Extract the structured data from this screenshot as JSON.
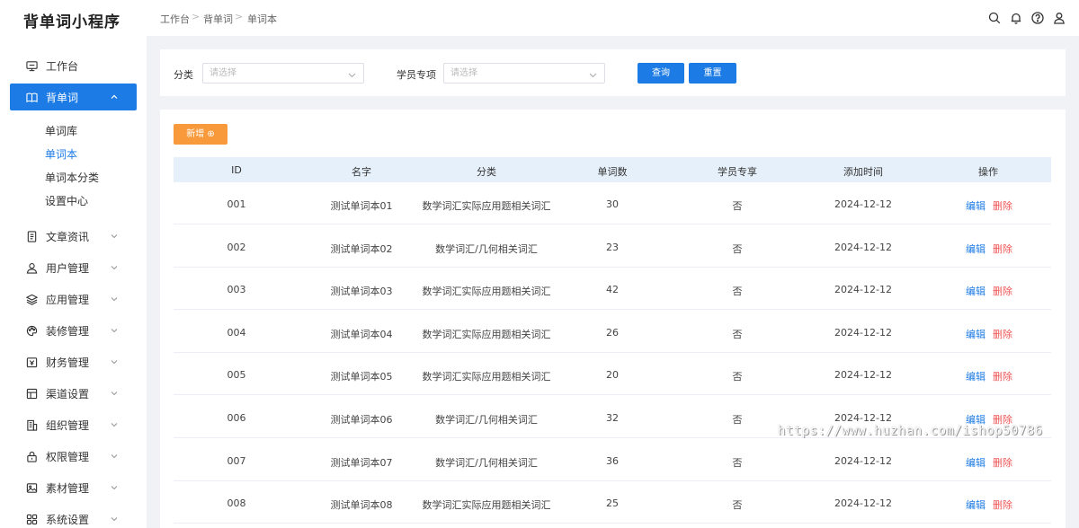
{
  "app": {
    "title": "背单词小程序"
  },
  "breadcrumb": [
    "工作台",
    "背单词",
    "单词本"
  ],
  "breadcrumb_sep": ">",
  "sidebar": {
    "items": [
      {
        "label": "工作台",
        "icon": "monitor-icon",
        "expandable": false
      },
      {
        "label": "背单词",
        "icon": "book-icon",
        "expandable": true,
        "expanded": true,
        "active": true
      },
      {
        "label": "文章资讯",
        "icon": "document-icon",
        "expandable": true
      },
      {
        "label": "用户管理",
        "icon": "user-icon",
        "expandable": true
      },
      {
        "label": "应用管理",
        "icon": "layers-icon",
        "expandable": true
      },
      {
        "label": "装修管理",
        "icon": "palette-icon",
        "expandable": true
      },
      {
        "label": "财务管理",
        "icon": "wallet-icon",
        "expandable": true
      },
      {
        "label": "渠道设置",
        "icon": "grid-icon",
        "expandable": true
      },
      {
        "label": "组织管理",
        "icon": "building-icon",
        "expandable": true
      },
      {
        "label": "权限管理",
        "icon": "lock-icon",
        "expandable": true
      },
      {
        "label": "素材管理",
        "icon": "image-icon",
        "expandable": true
      },
      {
        "label": "系统设置",
        "icon": "apps-icon",
        "expandable": true
      }
    ],
    "subitems": [
      {
        "label": "单词库",
        "active": false
      },
      {
        "label": "单词本",
        "active": true
      },
      {
        "label": "单词本分类",
        "active": false
      },
      {
        "label": "设置中心",
        "active": false
      }
    ]
  },
  "header_icons": [
    "search-icon",
    "bell-icon",
    "help-icon",
    "user-icon"
  ],
  "filters": {
    "category_label": "分类",
    "category_placeholder": "请选择",
    "student_label": "学员专项",
    "student_placeholder": "请选择",
    "query_label": "查询",
    "reset_label": "重置"
  },
  "toolbar": {
    "add_label": "新增 ⊕"
  },
  "table": {
    "columns": [
      "ID",
      "名字",
      "分类",
      "单词数",
      "学员专享",
      "添加时间",
      "操作"
    ],
    "rows": [
      {
        "id": "001",
        "name": "测试单词本01",
        "category": "数学词汇实际应用题相关词汇",
        "count": "30",
        "exclusive": "否",
        "added": "2024-12-12"
      },
      {
        "id": "002",
        "name": "测试单词本02",
        "category": "数学词汇/几何相关词汇",
        "count": "23",
        "exclusive": "否",
        "added": "2024-12-12"
      },
      {
        "id": "003",
        "name": "测试单词本03",
        "category": "数学词汇实际应用题相关词汇",
        "count": "42",
        "exclusive": "否",
        "added": "2024-12-12"
      },
      {
        "id": "004",
        "name": "测试单词本04",
        "category": "数学词汇实际应用题相关词汇",
        "count": "26",
        "exclusive": "否",
        "added": "2024-12-12"
      },
      {
        "id": "005",
        "name": "测试单词本05",
        "category": "数学词汇实际应用题相关词汇",
        "count": "20",
        "exclusive": "否",
        "added": "2024-12-12"
      },
      {
        "id": "006",
        "name": "测试单词本06",
        "category": "数学词汇/几何相关词汇",
        "count": "32",
        "exclusive": "否",
        "added": "2024-12-12"
      },
      {
        "id": "007",
        "name": "测试单词本07",
        "category": "数学词汇/几何相关词汇",
        "count": "36",
        "exclusive": "否",
        "added": "2024-12-12"
      },
      {
        "id": "008",
        "name": "测试单词本08",
        "category": "数学词汇实际应用题相关词汇",
        "count": "25",
        "exclusive": "否",
        "added": "2024-12-12"
      }
    ],
    "edit_label": "编辑",
    "delete_label": "删除"
  },
  "watermark": "https://www.huzhan.com/ishop50786",
  "colors": {
    "primary": "#1d7be6",
    "orange": "#f8993b",
    "danger": "#f05454",
    "header_row": "#e6f0fa"
  }
}
